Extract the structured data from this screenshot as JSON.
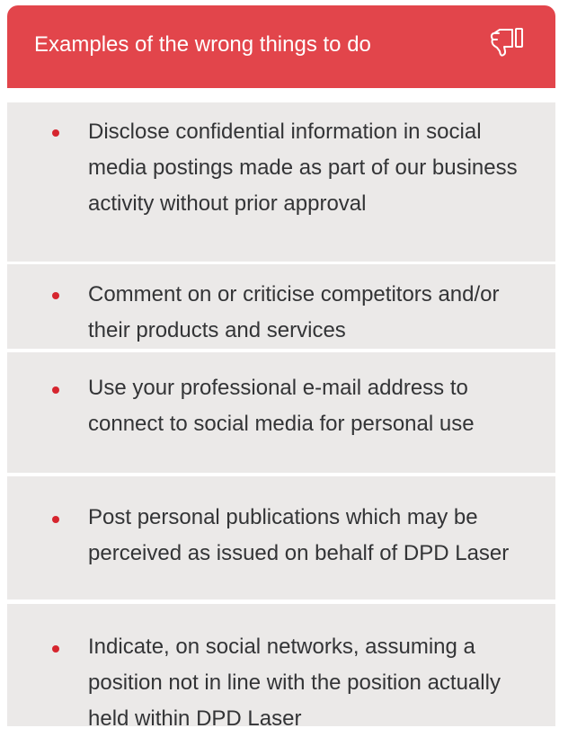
{
  "header": {
    "title": "Examples of the wrong things to do",
    "icon": "thumbs-down-icon",
    "background_color": "#e2454b"
  },
  "items": [
    {
      "text": "Disclose confidential information in social media postings made as part of our business activity without prior approval"
    },
    {
      "text": "Comment on or criticise competitors and/or their products and services"
    },
    {
      "text": "Use your professional e-mail address to connect to social media for personal use"
    },
    {
      "text": "Post personal publications which may be perceived as issued on behalf of DPD Laser"
    },
    {
      "text": "Indicate, on social networks, assuming a position not in line with the position actually held within DPD Laser"
    }
  ],
  "colors": {
    "item_background": "#ebe9e8",
    "bullet": "#d6252e",
    "text": "#333436"
  }
}
